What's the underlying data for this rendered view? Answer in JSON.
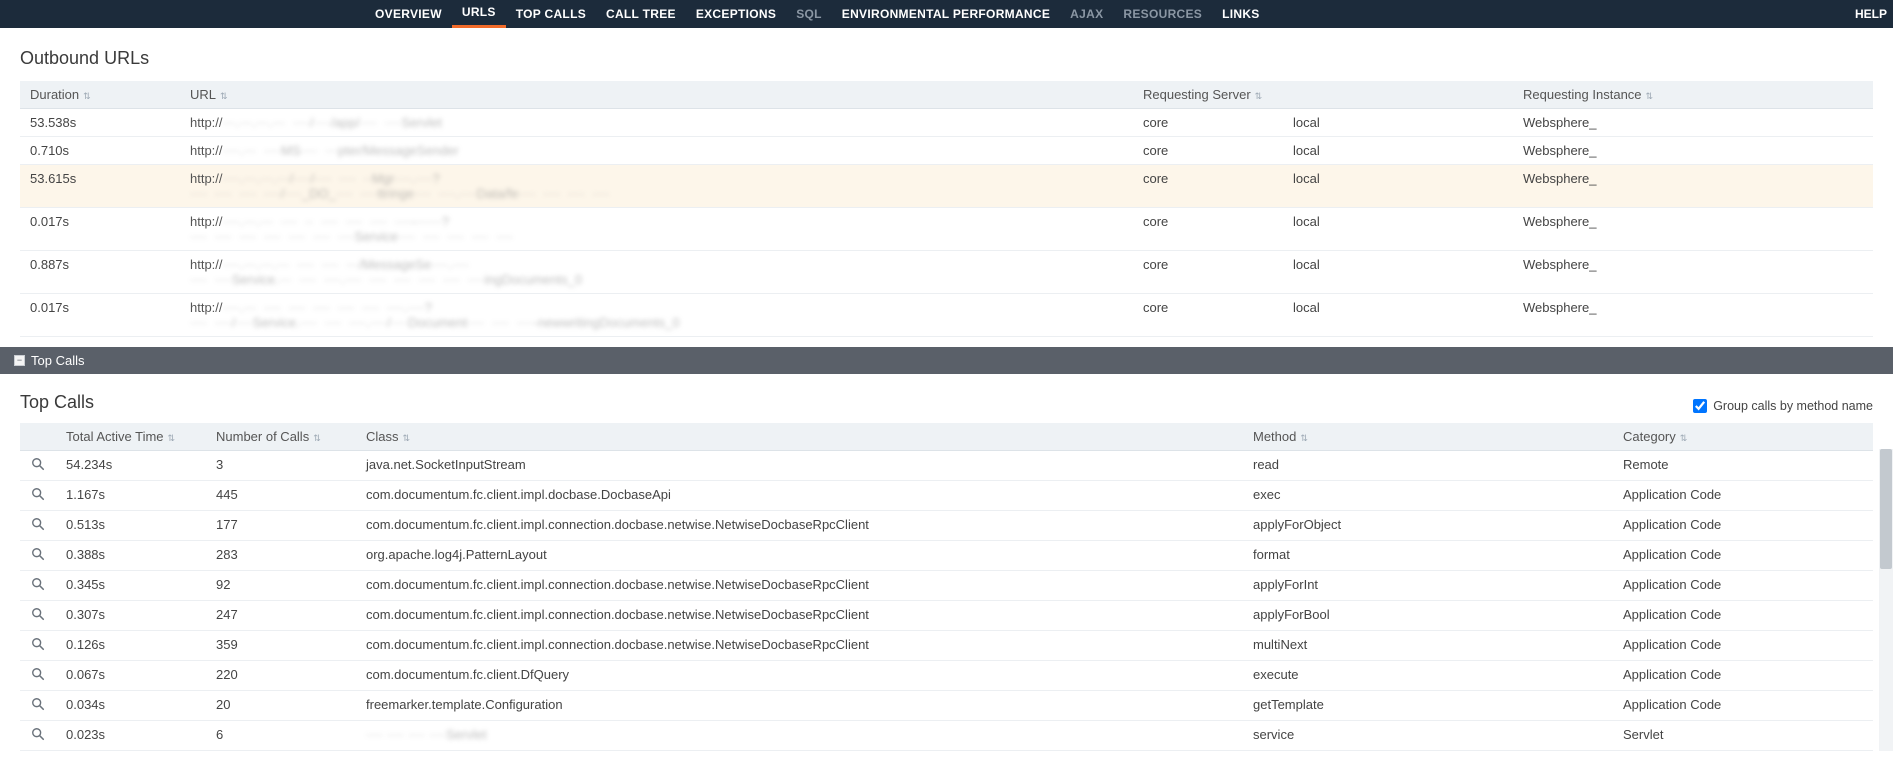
{
  "nav": {
    "items": [
      {
        "label": "OVERVIEW",
        "active": true
      },
      {
        "label": "URLS",
        "active": true,
        "underline": true
      },
      {
        "label": "TOP CALLS",
        "active": true
      },
      {
        "label": "CALL TREE",
        "active": true
      },
      {
        "label": "EXCEPTIONS",
        "active": true
      },
      {
        "label": "SQL",
        "muted": true
      },
      {
        "label": "ENVIRONMENTAL PERFORMANCE",
        "active": true
      },
      {
        "label": "AJAX",
        "muted": true
      },
      {
        "label": "RESOURCES",
        "muted": true
      },
      {
        "label": "LINKS",
        "active": true
      }
    ],
    "help": "HELP"
  },
  "outbound": {
    "title": "Outbound URLs",
    "headers": {
      "duration": "Duration",
      "url": "URL",
      "server": "Requesting Server",
      "server2": "",
      "instance": "Requesting Instance"
    },
    "rows": [
      {
        "duration": "53.538s",
        "url_prefix": "http://",
        "url_rest": "···.···.···.···  ····/····/app/····  ····Servlet",
        "server": "core",
        "server2": "local",
        "instance": "Websphere_"
      },
      {
        "duration": "0.710s",
        "url_prefix": "http://",
        "url_rest": "····.···  ····MS····  ···pter/MessageSender",
        "server": "core",
        "server2": "local",
        "instance": "Websphere_"
      },
      {
        "duration": "53.615s",
        "url_prefix": "http://",
        "url_rest": "····.···.···.···/····/····  ····  ··Mgr····.····?\n····  ····  ····  ····/····_DO_····  ····ttringe····  ····.····Data/fe····  ····  ····  ····",
        "server": "core",
        "server2": "local",
        "instance": "Websphere_",
        "highlight": true
      },
      {
        "duration": "0.017s",
        "url_prefix": "http://",
        "url_rest": "····.···.···  ····  ··  ····  ····  ····  ····-······?\n····  ····  ····  ····  ····  ····  ····Service····  ····  ····  ····  ····",
        "server": "core",
        "server2": "local",
        "instance": "Websphere_"
      },
      {
        "duration": "0.887s",
        "url_prefix": "http://",
        "url_rest": "····.···.···.···  ····  ····  ···/MessageSe····.····\n····  ····Service.···  ····  ····.····  ····  ····  ····  ····  ····ingDocuments_0",
        "server": "core",
        "server2": "local",
        "instance": "Websphere_"
      },
      {
        "duration": "0.017s",
        "url_prefix": "http://",
        "url_rest": "····.···  ····  ····  ····  ····  ····  ····.····?\n····  ····/····Service.····  ····  ····.····/····Document····  ····  ····-newwritingDocuments_0",
        "server": "core",
        "server2": "local",
        "instance": "Websphere_"
      }
    ]
  },
  "topcalls_bar": {
    "label": "Top Calls"
  },
  "topcalls": {
    "title": "Top Calls",
    "group_label": "Group calls by method name",
    "group_checked": true,
    "headers": {
      "time": "Total Active Time",
      "num": "Number of Calls",
      "class": "Class",
      "method": "Method",
      "category": "Category"
    },
    "rows": [
      {
        "time": "54.234s",
        "num": "3",
        "class": "java.net.SocketInputStream",
        "method": "read",
        "category": "Remote"
      },
      {
        "time": "1.167s",
        "num": "445",
        "class": "com.documentum.fc.client.impl.docbase.DocbaseApi",
        "method": "exec",
        "category": "Application Code"
      },
      {
        "time": "0.513s",
        "num": "177",
        "class": "com.documentum.fc.client.impl.connection.docbase.netwise.NetwiseDocbaseRpcClient",
        "method": "applyForObject",
        "category": "Application Code"
      },
      {
        "time": "0.388s",
        "num": "283",
        "class": "org.apache.log4j.PatternLayout",
        "method": "format",
        "category": "Application Code"
      },
      {
        "time": "0.345s",
        "num": "92",
        "class": "com.documentum.fc.client.impl.connection.docbase.netwise.NetwiseDocbaseRpcClient",
        "method": "applyForInt",
        "category": "Application Code"
      },
      {
        "time": "0.307s",
        "num": "247",
        "class": "com.documentum.fc.client.impl.connection.docbase.netwise.NetwiseDocbaseRpcClient",
        "method": "applyForBool",
        "category": "Application Code"
      },
      {
        "time": "0.126s",
        "num": "359",
        "class": "com.documentum.fc.client.impl.connection.docbase.netwise.NetwiseDocbaseRpcClient",
        "method": "multiNext",
        "category": "Application Code"
      },
      {
        "time": "0.067s",
        "num": "220",
        "class": "com.documentum.fc.client.DfQuery",
        "method": "execute",
        "category": "Application Code"
      },
      {
        "time": "0.034s",
        "num": "20",
        "class": "freemarker.template.Configuration",
        "method": "getTemplate",
        "category": "Application Code"
      },
      {
        "time": "0.023s",
        "num": "6",
        "class": "····  ····  ····  ····Servlet",
        "class_blur": true,
        "method": "service",
        "category": "Servlet"
      }
    ]
  }
}
